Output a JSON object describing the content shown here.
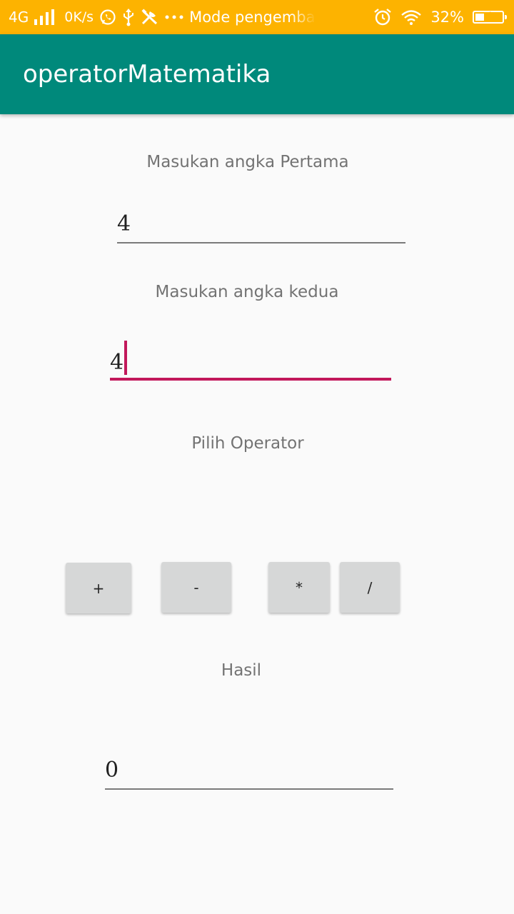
{
  "status_bar": {
    "network": "4G",
    "speed": "0K/s",
    "mode_text": "Mode pengembang",
    "battery": "32%",
    "battery_level": 0.32,
    "background_color": "#fdb300"
  },
  "app_bar": {
    "title": "operatorMatematika",
    "background_color": "#00897b"
  },
  "form": {
    "first_label": "Masukan angka Pertama",
    "first_value": "4",
    "second_label": "Masukan angka kedua",
    "second_value": "4",
    "operator_label": "Pilih Operator",
    "buttons": {
      "add": "+",
      "subtract": "-",
      "multiply": "*",
      "divide": "/"
    },
    "result_label": "Hasil",
    "result_value": "0"
  },
  "colors": {
    "focus_accent": "#c2185b",
    "button_bg": "#d6d7d7"
  },
  "icons": [
    "signal-icon",
    "whatsapp-icon",
    "usb-icon",
    "tools-icon",
    "more-icon",
    "alarm-icon",
    "wifi-icon",
    "battery-icon"
  ]
}
